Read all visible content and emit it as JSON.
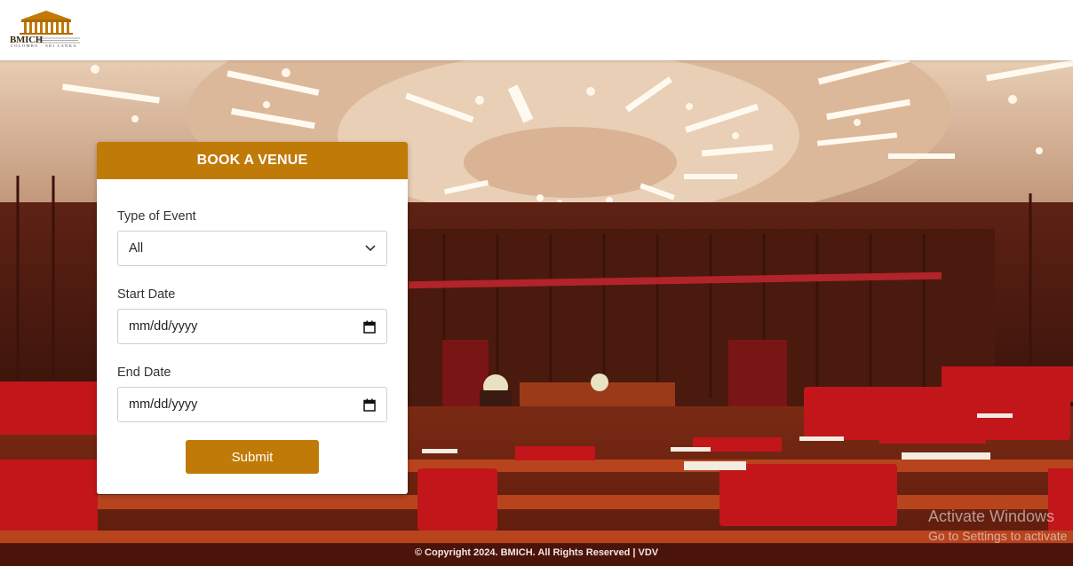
{
  "header": {
    "logo_text": "BMICH",
    "logo_subtext": "COLOMBO · SRI LANKA"
  },
  "booking": {
    "title": "BOOK A VENUE",
    "event_type_label": "Type of Event",
    "event_type_value": "All",
    "start_date_label": "Start Date",
    "start_date_placeholder": "mm/dd/yyyy",
    "end_date_label": "End Date",
    "end_date_placeholder": "mm/dd/yyyy",
    "submit_label": "Submit"
  },
  "footer": {
    "copyright": "© Copyright 2024. BMICH. All Rights Reserved | VDV"
  },
  "watermark": {
    "line1": "Activate Windows",
    "line2": "Go to Settings to activate"
  },
  "colors": {
    "accent": "#c07a08",
    "header_bg": "#ffffff",
    "card_bg": "#ffffff"
  },
  "icons": {
    "dropdown": "chevron-down-icon",
    "date": "calendar-icon"
  }
}
